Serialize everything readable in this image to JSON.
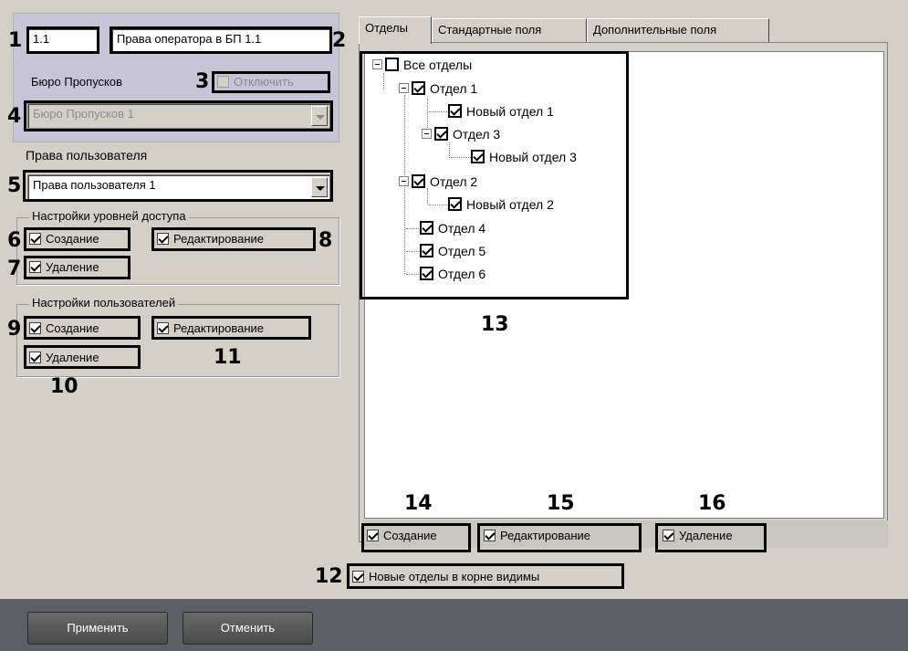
{
  "header": {
    "id_value": "1.1",
    "name_value": "Права оператора в БП 1.1",
    "bureau_label": "Бюро Пропусков",
    "disable_label": "Отключить",
    "bureau_select": "Бюро Пропусков 1"
  },
  "user_rights": {
    "label": "Права пользователя",
    "select_value": "Права пользователя 1"
  },
  "access_level_settings": {
    "title": "Настройки уровней доступа",
    "create_label": "Создание",
    "edit_label": "Редактирование",
    "delete_label": "Удаление"
  },
  "user_settings": {
    "title": "Настройки пользователей",
    "create_label": "Создание",
    "edit_label": "Редактирование",
    "delete_label": "Удаление"
  },
  "tabs": [
    {
      "label": "Отделы",
      "active": true
    },
    {
      "label": "Стандартные поля",
      "active": false
    },
    {
      "label": "Дополнительные поля",
      "active": false
    }
  ],
  "tree": {
    "root": "Все отделы",
    "items": [
      "Отдел 1",
      "Новый отдел 1",
      "Отдел 3",
      "Новый отдел 3",
      "Отдел 2",
      "Новый отдел 2",
      "Отдел 4",
      "Отдел 5",
      "Отдел 6"
    ]
  },
  "dept_actions": {
    "create_label": "Создание",
    "edit_label": "Редактирование",
    "delete_label": "Удаление"
  },
  "new_depts_root_visible_label": "Новые отделы в корне видимы",
  "footer": {
    "apply_label": "Применить",
    "cancel_label": "Отменить"
  },
  "callouts": [
    "1",
    "2",
    "3",
    "4",
    "5",
    "6",
    "7",
    "8",
    "9",
    "10",
    "11",
    "12",
    "13",
    "14",
    "15",
    "16"
  ]
}
